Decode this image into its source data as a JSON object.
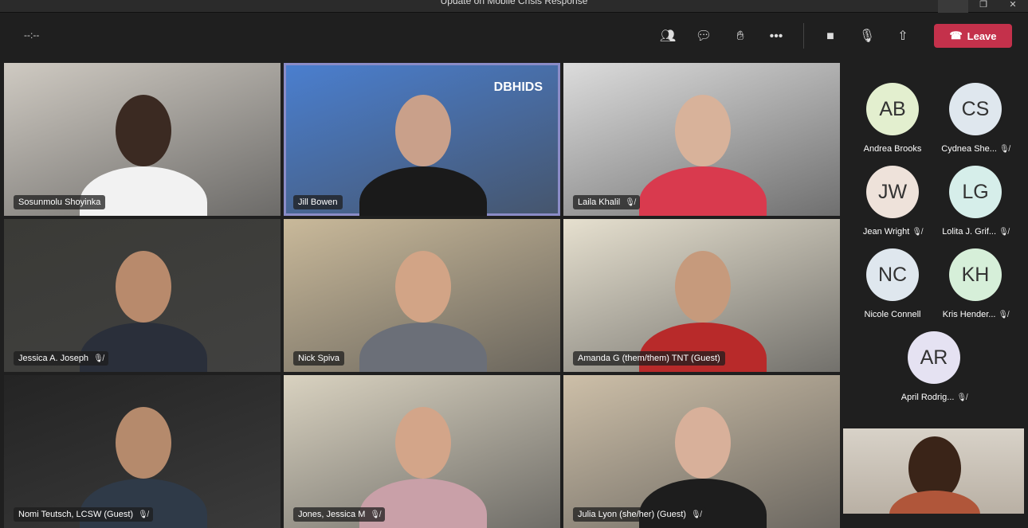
{
  "window": {
    "title": "Update on Mobile Crisis Response"
  },
  "toolbar": {
    "timer": "--:--",
    "leave_label": "Leave",
    "icons": [
      "people-icon",
      "chat-icon",
      "reactions-icon",
      "more-icon",
      "camera-icon",
      "mic-off-icon",
      "share-icon"
    ]
  },
  "colors": {
    "leave": "#c4314b",
    "active_speaker": "#8b8cc7"
  },
  "tiles": [
    {
      "name": "Sosunmolu Shoyinka",
      "muted": false,
      "bg": "#cfcac2",
      "skin": "#3b2a22",
      "shirt": "#f2f2f2"
    },
    {
      "name": "Jill Bowen",
      "muted": false,
      "bg": "#4a7fd0",
      "skin": "#c9a08a",
      "shirt": "#1a1a1a",
      "active": true,
      "logo": "DBHIDS"
    },
    {
      "name": "Laila Khalil",
      "muted": true,
      "bg": "#dcdcdc",
      "skin": "#d8b29a",
      "shirt": "#d93a4e"
    },
    {
      "name": "Jessica A. Joseph",
      "muted": true,
      "bg": "#3a3a36",
      "skin": "#b88a6c",
      "shirt": "#2a2f3a"
    },
    {
      "name": "Nick Spiva",
      "muted": false,
      "bg": "#c9b99a",
      "skin": "#d2a486",
      "shirt": "#6b6f78"
    },
    {
      "name": "Amanda G (them/them) TNT (Guest)",
      "muted": false,
      "bg": "#e6e0cf",
      "skin": "#c69a7c",
      "shirt": "#b82a2a"
    },
    {
      "name": "Nomi Teutsch, LCSW (Guest)",
      "muted": true,
      "bg": "#242424",
      "skin": "#b58a6c",
      "shirt": "#2f3a48"
    },
    {
      "name": "Jones, Jessica M",
      "muted": true,
      "bg": "#d9d2c0",
      "skin": "#d3a589",
      "shirt": "#c9a0a8"
    },
    {
      "name": "Julia Lyon (she/her) (Guest)",
      "muted": true,
      "bg": "#cdbfa8",
      "skin": "#d8b09a",
      "shirt": "#1d1d1d"
    }
  ],
  "roster": [
    {
      "initials": "AB",
      "name": "Andrea Brooks",
      "muted": false,
      "color": "#e3efcf"
    },
    {
      "initials": "CS",
      "name": "Cydnea She...",
      "muted": true,
      "color": "#dfe7ee"
    },
    {
      "initials": "JW",
      "name": "Jean Wright",
      "muted": true,
      "color": "#eee2da"
    },
    {
      "initials": "LG",
      "name": "Lolita J. Grif...",
      "muted": true,
      "color": "#d6eeea"
    },
    {
      "initials": "NC",
      "name": "Nicole Connell",
      "muted": false,
      "color": "#dfe7ee"
    },
    {
      "initials": "KH",
      "name": "Kris Hender...",
      "muted": true,
      "color": "#d6efd9"
    },
    {
      "initials": "AR",
      "name": "April Rodrig...",
      "muted": true,
      "color": "#e5e2f2"
    }
  ]
}
